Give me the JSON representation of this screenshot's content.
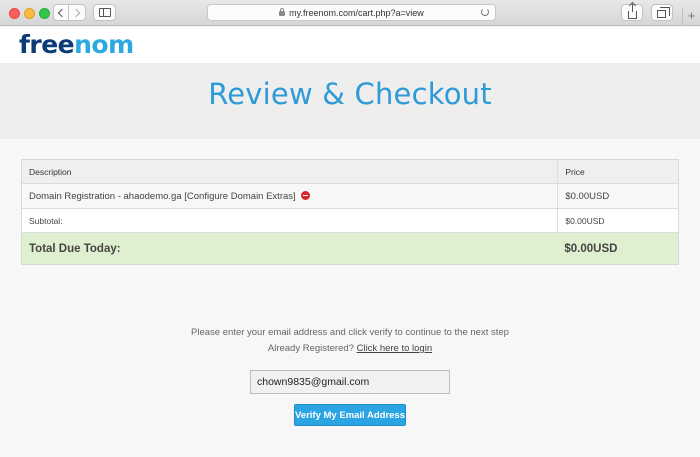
{
  "browser": {
    "url": "my.freenom.com/cart.php?a=view",
    "new_tab_label": "+"
  },
  "site": {
    "logo_part1": "free",
    "logo_part2": "nom"
  },
  "page": {
    "title": "Review & Checkout"
  },
  "cart": {
    "header": {
      "description": "Description",
      "price": "Price"
    },
    "items": [
      {
        "description": "Domain Registration - ahaodemo.ga [Configure Domain Extras]",
        "price": "$0.00USD"
      }
    ],
    "subtotal_label": "Subtotal:",
    "subtotal_value": "$0.00USD",
    "total_label": "Total Due Today:",
    "total_value": "$0.00USD"
  },
  "email": {
    "instruction": "Please enter your email address and click verify to continue to the next step",
    "registered_prefix": "Already Registered? ",
    "login_link": "Click here to login",
    "input_value": "chown9835@gmail.com",
    "verify_button": "Verify My Email Address"
  },
  "colors": {
    "accent": "#2e9ad7",
    "total_row": "#dff0d0",
    "button": "#2ba4e3",
    "remove": "#d9262b"
  }
}
